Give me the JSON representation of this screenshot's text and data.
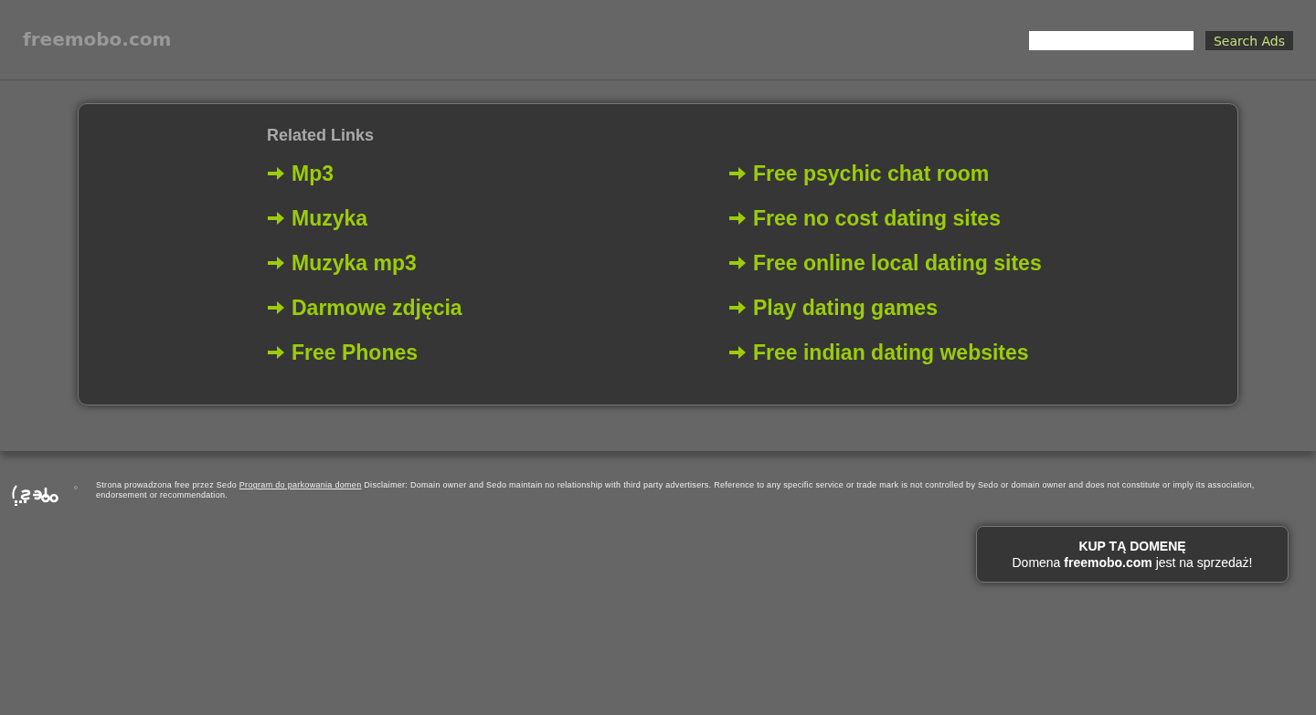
{
  "header": {
    "logo": "freemobo.com",
    "search": {
      "button": "Search Ads"
    }
  },
  "related": {
    "title": "Related Links",
    "columns": [
      [
        "Mp3",
        "Muzyka",
        "Muzyka mp3",
        "Darmowe zdjęcia",
        "Free Phones"
      ],
      [
        "Free psychic chat room",
        "Free no cost dating sites",
        "Free online local dating sites",
        "Play dating games",
        "Free indian dating websites"
      ]
    ]
  },
  "footer": {
    "text_before": "Strona prowadzona free przez Sedo",
    "link": "Program do parkowania domen",
    "text_after": "Disclaimer: Domain owner and Sedo maintain no relationship with third party advertisers. Reference to any specific service or trade mark is not controlled by Sedo or domain owner and does not constitute or imply its association, endorsement or recommendation."
  },
  "sale": {
    "title": "KUP TĄ DOMENĘ",
    "text": "Domena **freemobo.com** jest na sprzedaż!"
  }
}
